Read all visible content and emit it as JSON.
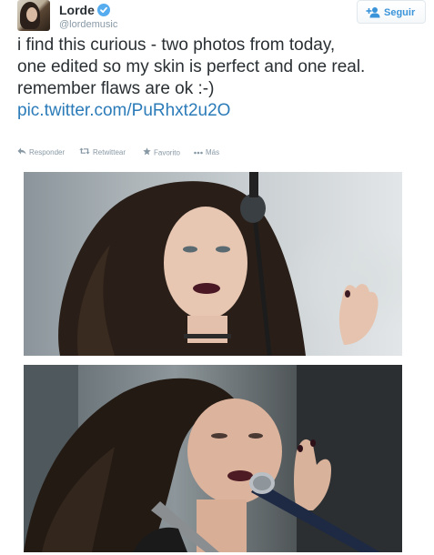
{
  "tweet": {
    "display_name": "Lorde",
    "screen_name": "@lordemusic",
    "follow_label": "Seguir",
    "text_lines": [
      "i find this curious - two photos from today,",
      "one edited so my skin is perfect and one real.",
      "remember flaws are ok :-)"
    ],
    "link": "pic.twitter.com/PuRhxt2u2O"
  },
  "actions": {
    "reply_label": "Responder",
    "retweet_label": "Retwittear",
    "favorite_label": "Favorito",
    "more_label": "Más"
  },
  "icons": {
    "avatar": "avatar",
    "verified": "verified-badge-icon",
    "follow": "follow-user-icon",
    "reply": "reply-icon",
    "retweet": "retweet-icon",
    "favorite": "star-icon",
    "more": "more-dots-icon"
  },
  "colors": {
    "link": "#2b7bb9",
    "accent": "#3b94d9",
    "verified": "#55acee",
    "muted": "#8899a6"
  }
}
